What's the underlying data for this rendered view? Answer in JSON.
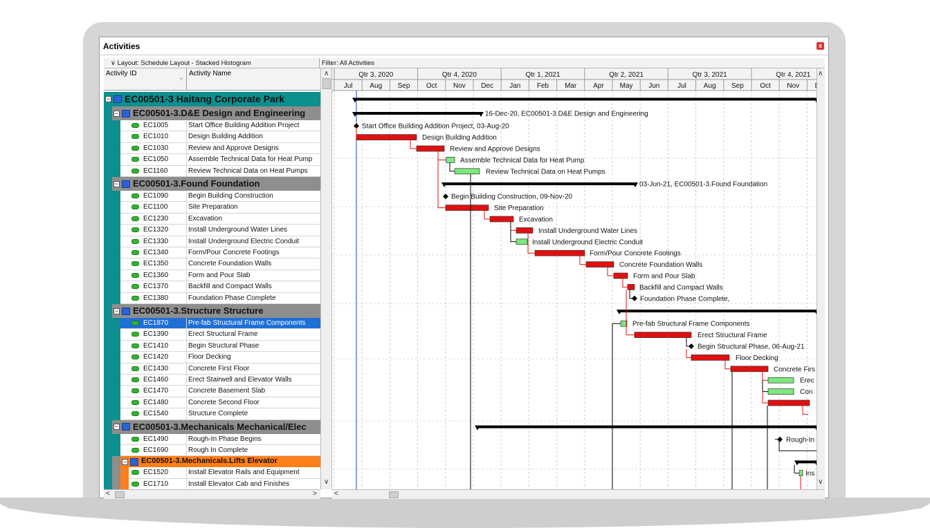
{
  "window": {
    "title": "Activities",
    "close_label": "x"
  },
  "layout_label": "Layout: Schedule Layout - Stacked Histogram",
  "filter_label": "Filter: All Activities",
  "columns": {
    "id": "Activity ID",
    "name": "Activity Name"
  },
  "rows": [
    {
      "kind": "wbs",
      "level": 0,
      "text": "EC00501-3  Haitang Corporate Park"
    },
    {
      "kind": "wbs",
      "level": 1,
      "text": "EC00501-3.D&E  Design and Engineering"
    },
    {
      "kind": "act",
      "id": "EC1005",
      "name": "Start Office Building Addition Project"
    },
    {
      "kind": "act",
      "id": "EC1010",
      "name": "Design Building Addition"
    },
    {
      "kind": "act",
      "id": "EC1030",
      "name": "Review and Approve Designs"
    },
    {
      "kind": "act",
      "id": "EC1050",
      "name": "Assemble Technical Data for Heat Pump"
    },
    {
      "kind": "act",
      "id": "EC1160",
      "name": "Review Technical Data on Heat Pumps"
    },
    {
      "kind": "wbs",
      "level": 1,
      "text": "EC00501-3.Found  Foundation"
    },
    {
      "kind": "act",
      "id": "EC1090",
      "name": "Begin Building Construction"
    },
    {
      "kind": "act",
      "id": "EC1100",
      "name": "Site Preparation"
    },
    {
      "kind": "act",
      "id": "EC1230",
      "name": "Excavation"
    },
    {
      "kind": "act",
      "id": "EC1320",
      "name": "Install Underground Water Lines"
    },
    {
      "kind": "act",
      "id": "EC1330",
      "name": "Install Underground Electric Conduit"
    },
    {
      "kind": "act",
      "id": "EC1340",
      "name": "Form/Pour Concrete Footings"
    },
    {
      "kind": "act",
      "id": "EC1350",
      "name": "Concrete Foundation Walls"
    },
    {
      "kind": "act",
      "id": "EC1360",
      "name": "Form and Pour Slab"
    },
    {
      "kind": "act",
      "id": "EC1370",
      "name": "Backfill and Compact Walls"
    },
    {
      "kind": "act",
      "id": "EC1380",
      "name": "Foundation Phase Complete"
    },
    {
      "kind": "wbs",
      "level": 1,
      "text": "EC00501-3.Structure  Structure"
    },
    {
      "kind": "act",
      "id": "EC1870",
      "name": "Pre-fab Structural Frame Components",
      "selected": true
    },
    {
      "kind": "act",
      "id": "EC1390",
      "name": "Erect Structural Frame"
    },
    {
      "kind": "act",
      "id": "EC1410",
      "name": "Begin Structural Phase"
    },
    {
      "kind": "act",
      "id": "EC1420",
      "name": "Floor Decking"
    },
    {
      "kind": "act",
      "id": "EC1430",
      "name": "Concrete First Floor"
    },
    {
      "kind": "act",
      "id": "EC1460",
      "name": "Erect Stairwell and Elevator Walls"
    },
    {
      "kind": "act",
      "id": "EC1470",
      "name": "Concrete Basement Slab"
    },
    {
      "kind": "act",
      "id": "EC1480",
      "name": "Concrete Second Floor"
    },
    {
      "kind": "act",
      "id": "EC1540",
      "name": "Structure Complete"
    },
    {
      "kind": "wbs",
      "level": 1,
      "text": "EC00501-3.Mechanicals  Mechanical/Elec"
    },
    {
      "kind": "act",
      "id": "EC1490",
      "name": "Rough-In Phase Begins"
    },
    {
      "kind": "act",
      "id": "EC1690",
      "name": "Rough In Complete"
    },
    {
      "kind": "wbs",
      "level": 2,
      "text": "EC00501-3.Mechanicals.Lifts  Elevator"
    },
    {
      "kind": "act2",
      "id": "EC1520",
      "name": "Install Elevator Rails and Equipment"
    },
    {
      "kind": "act2",
      "id": "EC1710",
      "name": "Install Elevator Cab and Finishes"
    }
  ],
  "timescale": {
    "quarters": [
      "Qtr 3, 2020",
      "Qtr 4, 2020",
      "Qtr 1, 2021",
      "Qtr 2, 2021",
      "Qtr 3, 2021",
      "Qtr 4, 2021"
    ],
    "months": [
      "Jul",
      "Aug",
      "Sep",
      "Oct",
      "Nov",
      "Dec",
      "Jan",
      "Feb",
      "Mar",
      "Apr",
      "May",
      "Jun",
      "Jul",
      "Aug",
      "Sep",
      "Oct",
      "Nov",
      "Dec"
    ]
  },
  "gantt_labels": {
    "de": "16-Dec-20, EC00501-3.D&E  Design and Engineering",
    "start": "Start Office Building Addition Project, 03-Aug-20",
    "design": "Design Building Addition",
    "review": "Review and Approve Designs",
    "assemble": "Assemble Technical Data for Heat Pump",
    "review_tech": "Review Technical Data on Heat Pumps",
    "found": "03-Jun-21, EC00501-3.Found  Foundation",
    "begin_bldg": "Begin Building Construction, 09-Nov-20",
    "site": "Site Preparation",
    "excavation": "Excavation",
    "water": "Install Underground Water Lines",
    "electric": "Install Underground Electric Conduit",
    "footings": "Form/Pour Concrete Footings",
    "fwalls": "Concrete Foundation Walls",
    "slab": "Form and Pour Slab",
    "backfill": "Backfill and Compact Walls",
    "fcomplete": "Foundation Phase Complete,",
    "prefab": "Pre-fab Structural Frame Components",
    "erect": "Erect Structural Frame",
    "begin_struct": "Begin Structural Phase, 06-Aug-21",
    "decking": "Floor Decking",
    "first_floor": "Concrete Firs",
    "erec": "Erec",
    "con": "Con",
    "rough": "Rough-In",
    "ins": "Ins"
  },
  "colors": {
    "critical": "#e01010",
    "noncritical": "#7ee87e",
    "wbs_teal": "#0d8f8f",
    "wbs_gray": "#8e8e8e",
    "wbs_orange": "#ff7f1a",
    "selection": "#1e6fd6"
  }
}
